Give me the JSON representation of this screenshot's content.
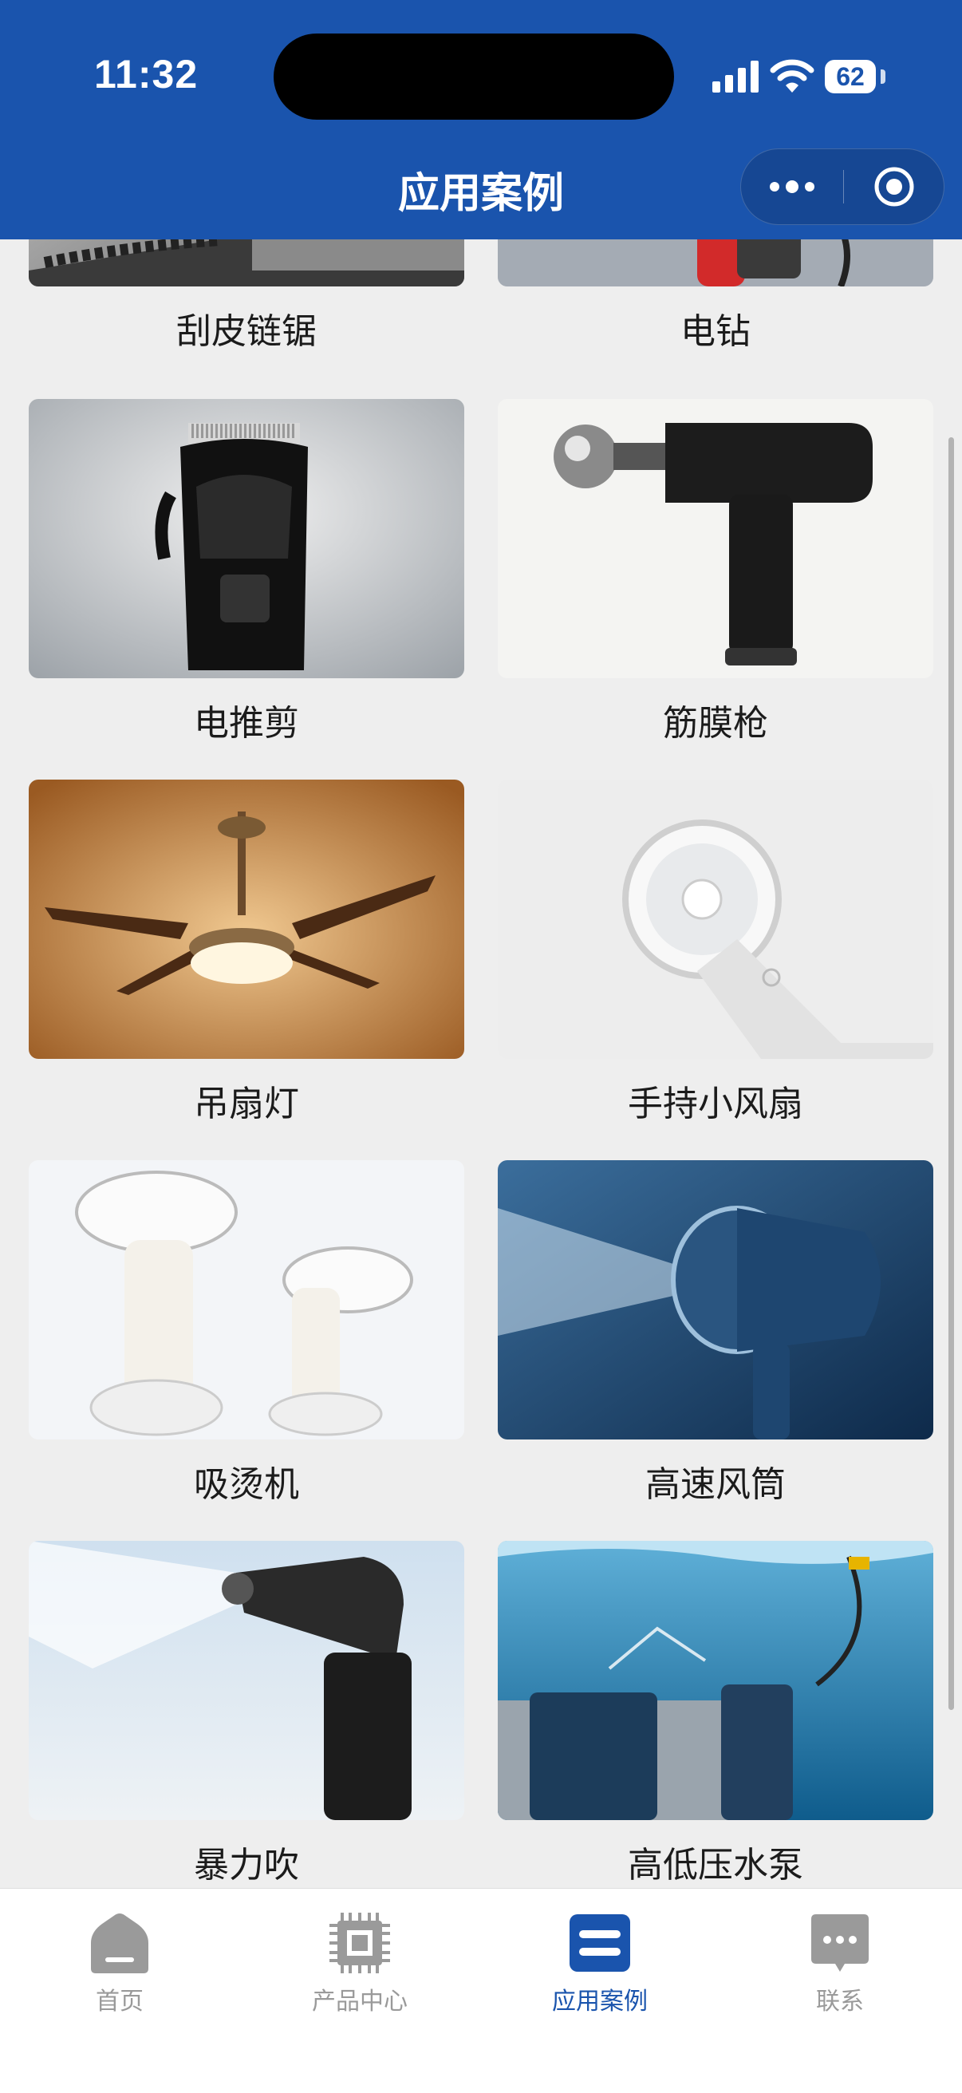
{
  "status_bar": {
    "time": "11:32",
    "battery": "62"
  },
  "header": {
    "title": "应用案例"
  },
  "cases": [
    {
      "label": "刮皮链锯"
    },
    {
      "label": "电钻"
    },
    {
      "label": "电推剪"
    },
    {
      "label": "筋膜枪"
    },
    {
      "label": "吊扇灯"
    },
    {
      "label": "手持小风扇"
    },
    {
      "label": "吸烫机"
    },
    {
      "label": "高速风筒"
    },
    {
      "label": "暴力吹"
    },
    {
      "label": "高低压水泵"
    }
  ],
  "tabbar": {
    "items": [
      {
        "label": "首页",
        "icon": "home-icon",
        "active": false
      },
      {
        "label": "产品中心",
        "icon": "chip-icon",
        "active": false
      },
      {
        "label": "应用案例",
        "icon": "cases-icon",
        "active": true
      },
      {
        "label": "联系",
        "icon": "chat-icon",
        "active": false
      }
    ],
    "active_color": "#1a54ad",
    "inactive_color": "#9a9a9a"
  },
  "colors": {
    "header": "#1a54ad",
    "background": "#eeeeee"
  }
}
